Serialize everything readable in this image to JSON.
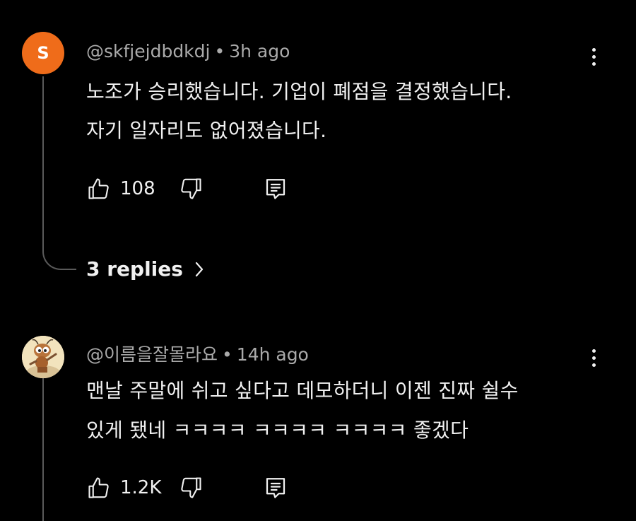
{
  "comments": [
    {
      "avatar_letter": "S",
      "avatar_color": "#ef6c1a",
      "username": "@skfjejdbdkdj",
      "separator": "•",
      "time": "3h ago",
      "lines": [
        "노조가 승리했습니다. 기업이 폐점을 결정했습니다.",
        "자기 일자리도 없어졌습니다."
      ],
      "likes": "108",
      "replies_label": "3 replies"
    },
    {
      "username": "@이름을잘몰라요",
      "separator": "•",
      "time": "14h ago",
      "lines": [
        "맨날 주말에 쉬고 싶다고 데모하더니 이젠 진짜 쉴수",
        "있게 됐네 ㅋㅋㅋㅋ ㅋㅋㅋㅋ ㅋㅋㅋㅋ   좋겠다"
      ],
      "likes": "1.2K"
    }
  ],
  "icons": {
    "like": "thumbs-up-icon",
    "dislike": "thumbs-down-icon",
    "reply": "reply-comment-icon",
    "more": "more-vertical-icon",
    "chevron": "chevron-right-icon"
  },
  "colors": {
    "background": "#000000",
    "text": "#f1f1f1",
    "meta": "#aaaaaa",
    "thread": "#5a5a5a"
  }
}
